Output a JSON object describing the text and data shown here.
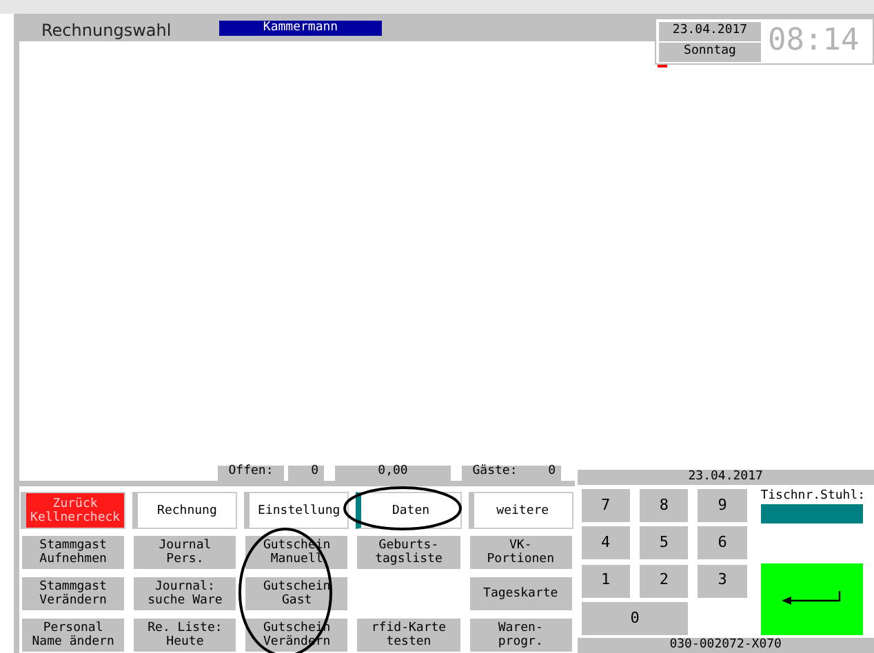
{
  "title": "Rechnungswahl",
  "user": "Kammermann",
  "date": "23.04.2017",
  "weekday": "Sonntag",
  "clock": "08:14",
  "status": {
    "open_label": "Offen:",
    "open_value": "0",
    "amount": "0,00",
    "guests_label": "Gäste:",
    "guests_value": "0"
  },
  "tabs": [
    {
      "label": "Zurück\nKellnercheck",
      "kind": "back",
      "selected": false
    },
    {
      "label": "Rechnung",
      "kind": "tab",
      "selected": false
    },
    {
      "label": "Einstellung",
      "kind": "tab",
      "selected": false
    },
    {
      "label": "Daten",
      "kind": "tab",
      "selected": true
    },
    {
      "label": "weitere",
      "kind": "tab",
      "selected": false
    }
  ],
  "buttons": [
    {
      "kind": "button",
      "label": "Stammgast\nAufnehmen"
    },
    {
      "kind": "button",
      "label": "Journal\nPers."
    },
    {
      "kind": "button",
      "label": "Gutschein\nManuell"
    },
    {
      "kind": "button",
      "label": "Geburts-\ntagsliste"
    },
    {
      "kind": "button",
      "label": "VK-\nPortionen"
    },
    {
      "kind": "button",
      "label": "Stammgast\nVerändern"
    },
    {
      "kind": "button",
      "label": "Journal:\nsuche Ware"
    },
    {
      "kind": "button",
      "label": "Gutschein\nGast"
    },
    {
      "kind": "empty"
    },
    {
      "kind": "button",
      "label": "Tageskarte"
    },
    {
      "kind": "button",
      "label": "Personal\nName ändern"
    },
    {
      "kind": "button",
      "label": "Re. Liste:\nHeute"
    },
    {
      "kind": "button",
      "label": "Gutschein\nVerändern"
    },
    {
      "kind": "button",
      "label": "rfid-Karte\ntesten"
    },
    {
      "kind": "button",
      "label": "Waren-\nprogr."
    }
  ],
  "numpad": {
    "date": "23.04.2017",
    "keys": [
      "7",
      "8",
      "9",
      "4",
      "5",
      "6",
      "1",
      "2",
      "3",
      "0"
    ],
    "table_label": "Tischnr.Stuhl:",
    "footer": "030-002072-X070"
  }
}
